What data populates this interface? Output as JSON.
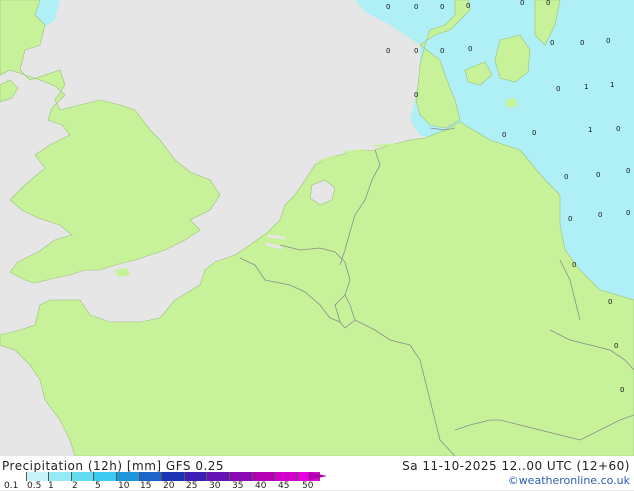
{
  "title": "Precipitation (12h) [mm] GFS 0.25",
  "valid_time": "Sa 11-10-2025 12..00 UTC (12+60)",
  "credit": "©weatheronline.co.uk",
  "colors": {
    "land": "#c8f299",
    "sea": "#e6e6e6",
    "precip_light": "#aef0f5",
    "border": "#8c8c8c"
  },
  "scale": {
    "labels": [
      "0.1",
      "0.5",
      "1",
      "2",
      "5",
      "10",
      "15",
      "20",
      "25",
      "30",
      "35",
      "40",
      "45",
      "50"
    ],
    "colors": [
      "#ffffff",
      "#c8f4f8",
      "#96eaf4",
      "#64dcf0",
      "#3cc8f0",
      "#1e96dc",
      "#1e64c8",
      "#1e32b4",
      "#3c1eb4",
      "#6414b4",
      "#8c0ab4",
      "#b400b4",
      "#d200c8",
      "#e600dc"
    ]
  },
  "precip_values": [
    {
      "text": "0"
    },
    {
      "text": "0"
    },
    {
      "text": "0"
    },
    {
      "text": "0"
    },
    {
      "text": "0"
    },
    {
      "text": "0"
    },
    {
      "text": "0"
    },
    {
      "text": "0"
    },
    {
      "text": "0"
    },
    {
      "text": "0"
    },
    {
      "text": "0"
    },
    {
      "text": "0"
    },
    {
      "text": "0"
    },
    {
      "text": "0"
    },
    {
      "text": "0"
    },
    {
      "text": "1"
    },
    {
      "text": "1"
    },
    {
      "text": "0"
    },
    {
      "text": "0"
    },
    {
      "text": "1"
    },
    {
      "text": "0"
    },
    {
      "text": "0"
    },
    {
      "text": "0"
    },
    {
      "text": "0"
    },
    {
      "text": "0"
    },
    {
      "text": "0"
    },
    {
      "text": "0"
    },
    {
      "text": "0"
    },
    {
      "text": "0"
    },
    {
      "text": "0"
    },
    {
      "text": "0"
    }
  ]
}
